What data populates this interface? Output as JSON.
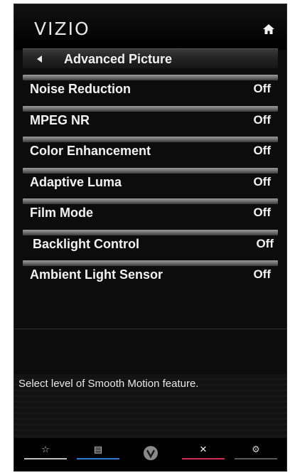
{
  "header": {
    "brand": "VIZIO",
    "home_icon": "home-icon"
  },
  "title_bar": {
    "title": "Advanced Picture",
    "back_icon": "back-arrow-icon"
  },
  "menu": {
    "items": [
      {
        "label": "Noise Reduction",
        "value": "Off"
      },
      {
        "label": "MPEG NR",
        "value": "Off"
      },
      {
        "label": "Color Enhancement",
        "value": "Off"
      },
      {
        "label": "Adaptive Luma",
        "value": "Off"
      },
      {
        "label": "Film Mode",
        "value": "Off"
      },
      {
        "label": "Backlight Control",
        "value": "Off"
      },
      {
        "label": "Ambient Light Sensor",
        "value": "Off"
      }
    ]
  },
  "help": {
    "text": "Select level of Smooth Motion feature."
  },
  "nav": {
    "buttons": [
      {
        "icon": "star-icon",
        "color": "#bfbfbf"
      },
      {
        "icon": "widget-icon",
        "color": "#2a7fd4"
      },
      {
        "icon": "v-logo-icon",
        "color": "#8a8a8a"
      },
      {
        "icon": "close-icon",
        "color": "#d42a55"
      },
      {
        "icon": "gear-icon",
        "color": "#9a9a9a"
      }
    ]
  }
}
